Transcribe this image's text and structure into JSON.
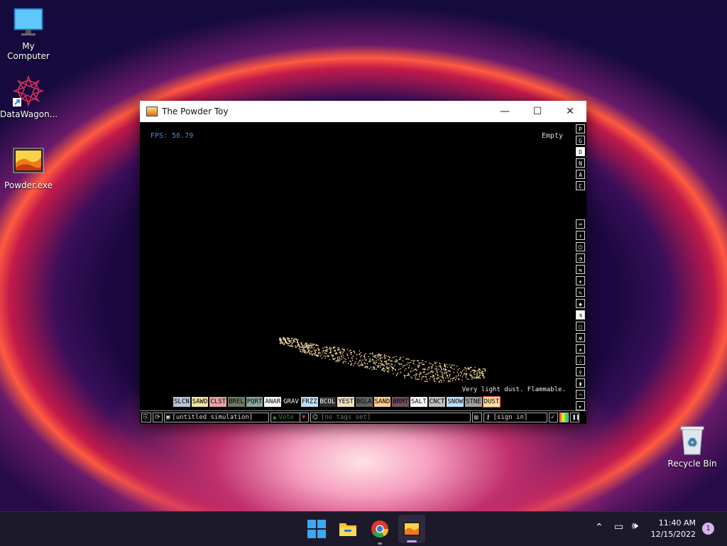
{
  "desktop": {
    "icons": [
      {
        "label": "My Computer"
      },
      {
        "label": "DataWagon..."
      },
      {
        "label": "Powder.exe"
      },
      {
        "label": "Recycle Bin"
      }
    ]
  },
  "window": {
    "title": "The Powder Toy",
    "controls": {
      "minimize": "—",
      "maximize": "☐",
      "close": "✕"
    }
  },
  "sim": {
    "fps": "FPS: 56.79",
    "hover_status": "Empty",
    "element_description": "Very light dust. Flammable.",
    "elements": [
      {
        "label": "SLCN",
        "bg": "#b8c4dc",
        "fg": "#000"
      },
      {
        "label": "SAWD",
        "bg": "#f0e4a0",
        "fg": "#000"
      },
      {
        "label": "CLST",
        "bg": "#e4a4a4",
        "fg": "#000"
      },
      {
        "label": "BREL",
        "bg": "#707a60",
        "fg": "#000"
      },
      {
        "label": "PQRT",
        "bg": "#88a8a0",
        "fg": "#000"
      },
      {
        "label": "ANAR",
        "bg": "#ffffff",
        "fg": "#000"
      },
      {
        "label": "GRAV",
        "bg": "#000000",
        "fg": "#fff"
      },
      {
        "label": "FRZZ",
        "bg": "#c0e0ff",
        "fg": "#000"
      },
      {
        "label": "BCOL",
        "bg": "#303030",
        "fg": "#fff"
      },
      {
        "label": "YEST",
        "bg": "#f0e0c0",
        "fg": "#000"
      },
      {
        "label": "BGLA",
        "bg": "#606060",
        "fg": "#000"
      },
      {
        "label": "SAND",
        "bg": "#ffd090",
        "fg": "#000"
      },
      {
        "label": "BRMT",
        "bg": "#705060",
        "fg": "#000"
      },
      {
        "label": "SALT",
        "bg": "#ffffff",
        "fg": "#000"
      },
      {
        "label": "CNCT",
        "bg": "#c0c0c0",
        "fg": "#000"
      },
      {
        "label": "SNOW",
        "bg": "#c0e0ff",
        "fg": "#000"
      },
      {
        "label": "STNE",
        "bg": "#a0a0a0",
        "fg": "#000"
      },
      {
        "label": "DUST",
        "bg": "#ffe0a0",
        "fg": "#000"
      }
    ],
    "side_menu_top": [
      "P",
      "G",
      "D",
      "N",
      "A",
      "C"
    ],
    "side_menu_selected": "D",
    "side_menu_icons": [
      "keyboard-icon",
      "plug-icon",
      "power-icon",
      "gauge-icon",
      "sensor-icon",
      "explosive-icon",
      "pen-icon",
      "droplet-icon",
      "flask-icon",
      "box-icon",
      "radioactive-icon",
      "star-icon",
      "dots-icon",
      "bulb-icon",
      "bookmark-icon",
      "tool-icon",
      "pointer-icon"
    ]
  },
  "bottombar": {
    "simulation_name": "[untitled simulation]",
    "vote_label": "Vote",
    "tags": "[no tags set]",
    "signin": "[sign in]"
  },
  "taskbar": {
    "time": "11:40 AM",
    "date": "12/15/2022",
    "notifications": "1"
  },
  "colors": {
    "accent_fps": "#4f8fd6",
    "vote_green": "#3a8a3a",
    "vote_red": "#8a2a2a"
  }
}
